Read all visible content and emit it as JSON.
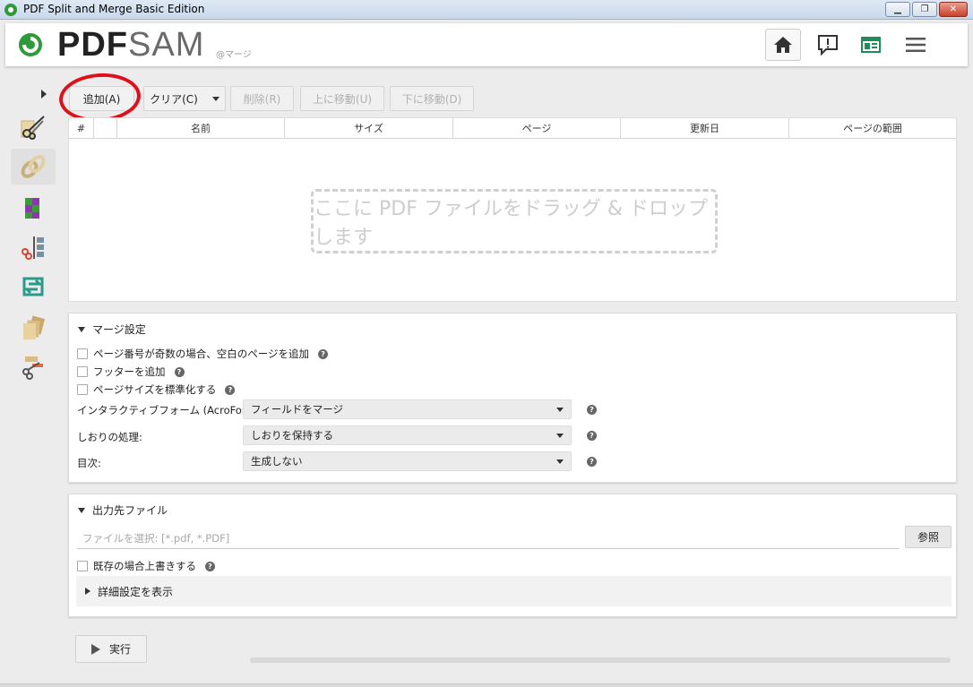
{
  "window": {
    "title": "PDF Split and Merge Basic Edition",
    "minimize": "▁",
    "maximize": "❐",
    "close": "✕"
  },
  "header": {
    "logo_bold": "PDF",
    "logo_light": "SAM",
    "logo_sub": "@マージ",
    "buttons": [
      "home-icon",
      "feedback-icon",
      "news-icon",
      "menu-icon"
    ]
  },
  "sidebar": {
    "items": [
      "split-tool-icon",
      "merge-tool-icon",
      "mix-tool-icon",
      "split-by-bookmarks-icon",
      "rotate-tool-icon",
      "extract-tool-icon",
      "split-by-size-icon"
    ],
    "active_index": 1
  },
  "toolbar": {
    "add": "追加(A)",
    "clear": "クリア(C)",
    "remove": "削除(R)",
    "move_up": "上に移動(U)",
    "move_down": "下に移動(D)"
  },
  "table": {
    "columns": [
      "#",
      "",
      "名前",
      "サイズ",
      "ページ",
      "更新日",
      "ページの範囲"
    ],
    "drop_hint": "ここに PDF ファイルをドラッグ & ドロップします"
  },
  "merge_settings": {
    "title": "マージ設定",
    "add_blank": "ページ番号が奇数の場合、空白のページを追加",
    "add_footer": "フッターを追加",
    "normalize": "ページサイズを標準化する",
    "acroforms_label": "インタラクティブフォーム (AcroForms):",
    "acroforms_value": "フィールドをマージ",
    "bookmarks_label": "しおりの処理:",
    "bookmarks_value": "しおりを保持する",
    "toc_label": "目次:",
    "toc_value": "生成しない"
  },
  "output": {
    "title": "出力先ファイル",
    "placeholder": "ファイルを選択: [*.pdf, *.PDF]",
    "browse": "参照",
    "overwrite": "既存の場合上書きする",
    "advanced": "詳細設定を表示"
  },
  "run": {
    "label": "実行",
    "progress": 0
  },
  "help_glyph": "?",
  "colors": {
    "logo_green": "#2e9a3a",
    "annotation_red": "#e0101a",
    "news_green": "#1f8c5a"
  }
}
